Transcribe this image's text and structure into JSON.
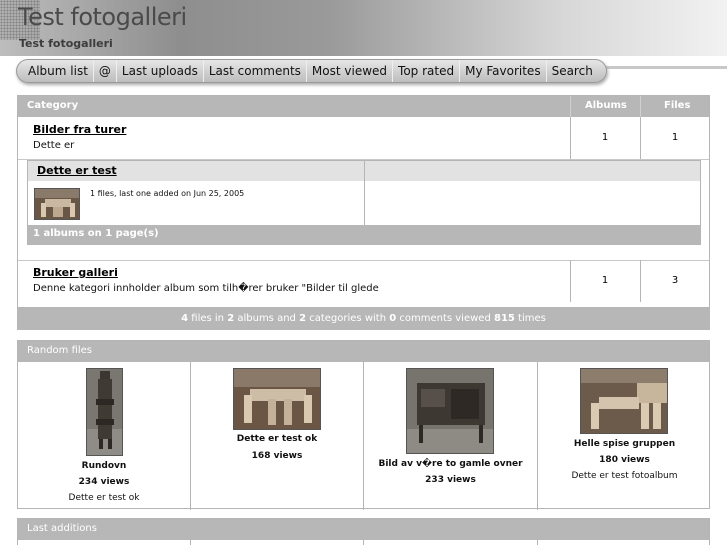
{
  "header": {
    "title": "Test fotogalleri",
    "subtitle": "Test fotogalleri"
  },
  "nav": {
    "items": [
      "Album list",
      "@",
      "Last uploads",
      "Last comments",
      "Most viewed",
      "Top rated",
      "My Favorites",
      "Search"
    ]
  },
  "categories_table": {
    "headers": {
      "category": "Category",
      "albums": "Albums",
      "files": "Files"
    },
    "rows": [
      {
        "name": "Bilder fra turer",
        "description": "Dette er",
        "albums": "1",
        "files": "1"
      },
      {
        "name": "Bruker galleri",
        "description": "Denne kategori innholder album som tilh�rer bruker \"Bilder til glede",
        "albums": "1",
        "files": "3"
      }
    ],
    "subalbum": {
      "name": "Dette er test",
      "info": "1 files, last one added on Jun 25, 2005",
      "footer": "1 albums on 1 page(s)"
    }
  },
  "stats": {
    "files": "4",
    "files_label": " files in ",
    "albums": "2",
    "albums_label": " albums and ",
    "categories": "2",
    "categories_label": " categories with ",
    "comments": "0",
    "comments_label": " comments viewed ",
    "views": "815",
    "views_label": " times"
  },
  "random_files": {
    "header": "Random files",
    "items": [
      {
        "title": "Rundovn",
        "views": "234 views",
        "description": "Dette er test ok"
      },
      {
        "title": "Dette er test ok",
        "views": "168 views",
        "description": ""
      },
      {
        "title": "Bild av v�re to gamle ovner",
        "views": "233 views",
        "description": ""
      },
      {
        "title": "Helle spise gruppen",
        "views": "180 views",
        "description": "Dette er test fotoalbum"
      }
    ]
  },
  "last_additions": {
    "header": "Last additions"
  }
}
